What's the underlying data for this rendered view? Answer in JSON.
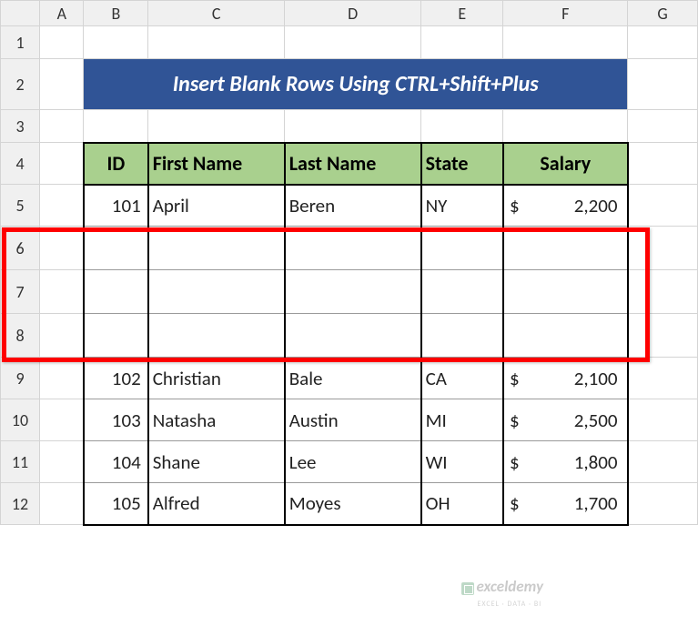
{
  "columns": [
    "A",
    "B",
    "C",
    "D",
    "E",
    "F",
    "G"
  ],
  "rows": [
    "1",
    "2",
    "3",
    "4",
    "5",
    "6",
    "7",
    "8",
    "9",
    "10",
    "11",
    "12"
  ],
  "title": "Insert Blank Rows Using CTRL+Shift+Plus",
  "headers": {
    "id": "ID",
    "first": "First Name",
    "last": "Last Name",
    "state": "State",
    "salary": "Salary"
  },
  "currency": "$",
  "data": {
    "r5": {
      "id": "101",
      "first": "April",
      "last": "Beren",
      "state": "NY",
      "salary": "2,200"
    },
    "r9": {
      "id": "102",
      "first": "Christian",
      "last": "Bale",
      "state": "CA",
      "salary": "2,100"
    },
    "r10": {
      "id": "103",
      "first": "Natasha",
      "last": "Austin",
      "state": "MI",
      "salary": "2,500"
    },
    "r11": {
      "id": "104",
      "first": "Shane",
      "last": "Lee",
      "state": "WI",
      "salary": "1,800"
    },
    "r12": {
      "id": "105",
      "first": "Alfred",
      "last": "Moyes",
      "state": "OH",
      "salary": "1,700"
    }
  },
  "watermark": {
    "title": "exceldemy",
    "sub": "EXCEL · DATA · BI"
  },
  "chart_data": {
    "type": "table",
    "title": "Insert Blank Rows Using CTRL+Shift+Plus",
    "columns": [
      "ID",
      "First Name",
      "Last Name",
      "State",
      "Salary"
    ],
    "rows": [
      {
        "ID": 101,
        "First Name": "April",
        "Last Name": "Beren",
        "State": "NY",
        "Salary": 2200
      },
      {
        "ID": 102,
        "First Name": "Christian",
        "Last Name": "Bale",
        "State": "CA",
        "Salary": 2100
      },
      {
        "ID": 103,
        "First Name": "Natasha",
        "Last Name": "Austin",
        "State": "MI",
        "Salary": 2500
      },
      {
        "ID": 104,
        "First Name": "Shane",
        "Last Name": "Lee",
        "State": "WI",
        "Salary": 1800
      },
      {
        "ID": 105,
        "First Name": "Alfred",
        "Last Name": "Moyes",
        "State": "OH",
        "Salary": 1700
      }
    ],
    "blank_rows_inserted_after_first_row": 3
  }
}
